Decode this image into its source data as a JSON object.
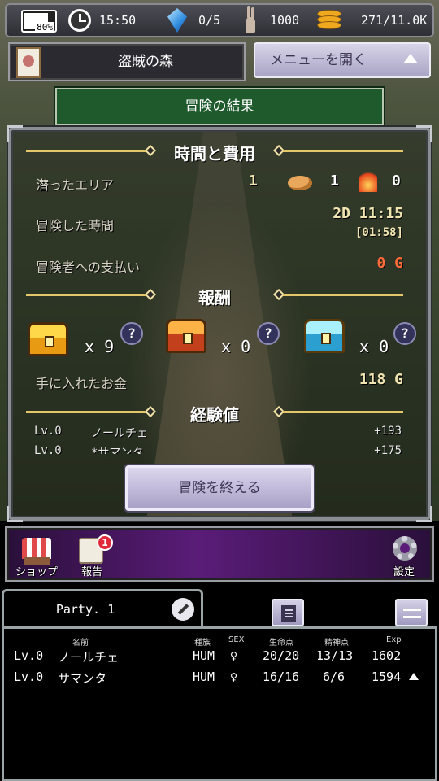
{
  "status_bar": {
    "battery": "80%",
    "battery_level": 0.8,
    "time": "15:50",
    "gems": "0/5",
    "rabbit_count": "1000",
    "gold": "271/11.0K"
  },
  "location": {
    "name": "盗賊の森",
    "menu_button": "メニューを開く"
  },
  "result": {
    "header": "冒険の結果",
    "time_cost": {
      "title": "時間と費用",
      "area_label": "潜ったエリア",
      "area_value": "1",
      "bread_count": "1",
      "fire_count": "0",
      "duration_label": "冒険した時間",
      "duration_value": "2D 11:15",
      "duration_real": "[01:58]",
      "payment_label": "冒険者への支払い",
      "payment_value": "0 G"
    },
    "reward": {
      "title": "報酬",
      "chests": [
        {
          "type": "gold",
          "count": "x 9"
        },
        {
          "type": "red",
          "count": "x 0"
        },
        {
          "type": "cyan",
          "count": "x 0"
        }
      ],
      "help": "?",
      "money_label": "手に入れたお金",
      "money_value": "118 G"
    },
    "experience": {
      "title": "経験値",
      "rows": [
        {
          "level": "Lv.0",
          "name": "ノールチェ",
          "exp": "+193"
        },
        {
          "level": "Lv.0",
          "name": "*サマンタ",
          "exp": "+175"
        }
      ]
    },
    "finish_button": "冒険を終える"
  },
  "nav": {
    "shop": "ショップ",
    "report": "報告",
    "report_badge": "1",
    "settings": "設定"
  },
  "party": {
    "name": "Party. 1",
    "headers": {
      "name": "名前",
      "race": "種族",
      "sex": "SEX",
      "hp": "生命点",
      "mp": "精神点",
      "exp": "Exp"
    },
    "members": [
      {
        "level": "Lv.0",
        "name": "ノールチェ",
        "race": "HUM",
        "sex": "♀",
        "hp": "20/20",
        "mp": "13/13",
        "exp": "1602"
      },
      {
        "level": "Lv.0",
        "name": "サマンタ",
        "race": "HUM",
        "sex": "♀",
        "hp": "16/16",
        "mp": "6/6",
        "exp": "1594"
      }
    ]
  }
}
